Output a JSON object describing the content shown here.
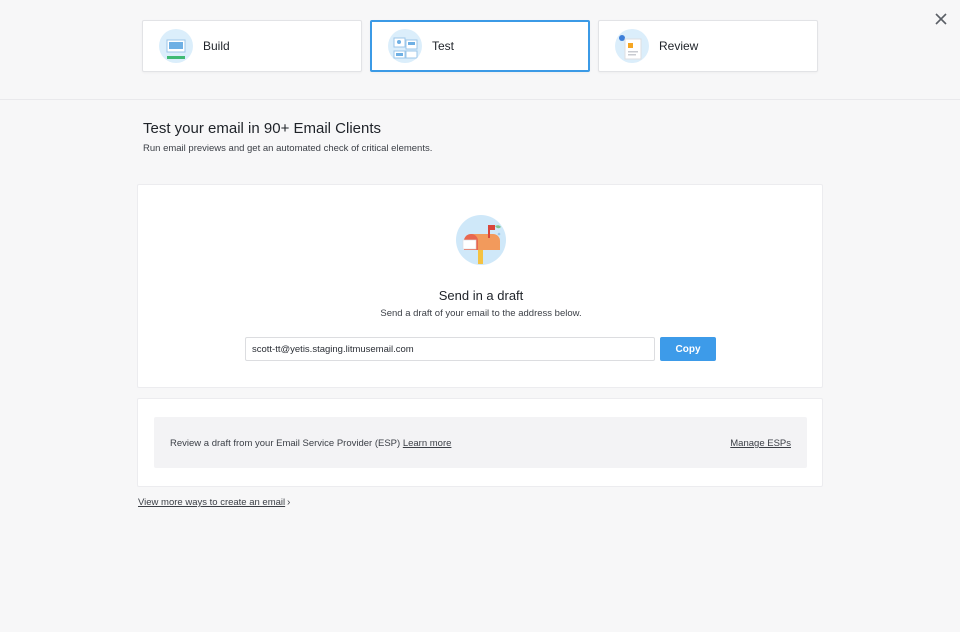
{
  "steps": [
    {
      "label": "Build",
      "icon": "build-illustration-icon",
      "active": false
    },
    {
      "label": "Test",
      "icon": "test-illustration-icon",
      "active": true
    },
    {
      "label": "Review",
      "icon": "review-illustration-icon",
      "active": false
    }
  ],
  "header": {
    "title": "Test your email in 90+ Email Clients",
    "subtitle": "Run email previews and get an automated check of critical elements."
  },
  "draft": {
    "title": "Send in a draft",
    "subtitle": "Send a draft of your email to the address below.",
    "email_value": "scott-tt@yetis.staging.litmusemail.com",
    "copy_label": "Copy"
  },
  "esp": {
    "text": "Review a draft from your Email Service Provider (ESP)",
    "learn_more": "Learn more",
    "manage_label": "Manage ESPs"
  },
  "footer": {
    "more_link": "View more ways to create an email",
    "chevron": "›"
  },
  "colors": {
    "accent": "#3d9be9",
    "page_bg": "#f7f7f8"
  }
}
